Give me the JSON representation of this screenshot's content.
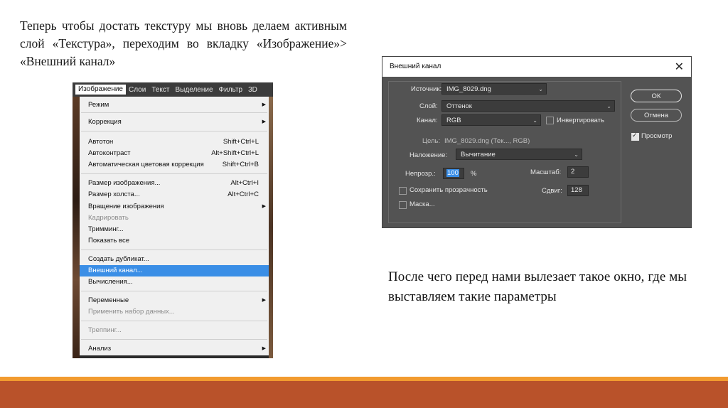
{
  "slide": {
    "top_text": "Теперь чтобы достать текстуру мы вновь делаем активным слой «Текстура», переходим во вкладку «Изображение»> «Внешний канал»",
    "bottom_text": "После чего перед нами вылезает такое окно, где мы выставляем такие параметры"
  },
  "menubar": {
    "items": [
      "Изображение",
      "Слои",
      "Текст",
      "Выделение",
      "Фильтр",
      "3D"
    ]
  },
  "image_menu": {
    "items": [
      {
        "label": "Режим",
        "shortcut": "",
        "submenu": true,
        "state": "normal"
      },
      {
        "label": "Коррекция",
        "shortcut": "",
        "submenu": true,
        "state": "normal"
      },
      {
        "label": "Автотон",
        "shortcut": "Shift+Ctrl+L",
        "submenu": false,
        "state": "normal"
      },
      {
        "label": "Автоконтраст",
        "shortcut": "Alt+Shift+Ctrl+L",
        "submenu": false,
        "state": "normal"
      },
      {
        "label": "Автоматическая цветовая коррекция",
        "shortcut": "Shift+Ctrl+B",
        "submenu": false,
        "state": "normal"
      },
      {
        "label": "Размер изображения...",
        "shortcut": "Alt+Ctrl+I",
        "submenu": false,
        "state": "normal"
      },
      {
        "label": "Размер холста...",
        "shortcut": "Alt+Ctrl+C",
        "submenu": false,
        "state": "normal"
      },
      {
        "label": "Вращение изображения",
        "shortcut": "",
        "submenu": true,
        "state": "normal"
      },
      {
        "label": "Кадрировать",
        "shortcut": "",
        "submenu": false,
        "state": "disabled"
      },
      {
        "label": "Тримминг...",
        "shortcut": "",
        "submenu": false,
        "state": "normal"
      },
      {
        "label": "Показать все",
        "shortcut": "",
        "submenu": false,
        "state": "normal"
      },
      {
        "label": "Создать дубликат...",
        "shortcut": "",
        "submenu": false,
        "state": "normal"
      },
      {
        "label": "Внешний канал...",
        "shortcut": "",
        "submenu": false,
        "state": "selected"
      },
      {
        "label": "Вычисления...",
        "shortcut": "",
        "submenu": false,
        "state": "normal"
      },
      {
        "label": "Переменные",
        "shortcut": "",
        "submenu": true,
        "state": "normal"
      },
      {
        "label": "Применить набор данных...",
        "shortcut": "",
        "submenu": false,
        "state": "disabled"
      },
      {
        "label": "Треппинг...",
        "shortcut": "",
        "submenu": false,
        "state": "disabled"
      },
      {
        "label": "Анализ",
        "shortcut": "",
        "submenu": true,
        "state": "normal"
      }
    ]
  },
  "dialog": {
    "title": "Внешний канал",
    "source_label": "Источник:",
    "source_value": "IMG_8029.dng",
    "layer_label": "Слой:",
    "layer_value": "Оттенок",
    "channel_label": "Канал:",
    "channel_value": "RGB",
    "invert_label": "Инвертировать",
    "invert_checked": false,
    "target_label": "Цель:",
    "target_value": "IMG_8029.dng (Тек..., RGB)",
    "blending_label": "Наложение:",
    "blending_value": "Вычитание",
    "opacity_label": "Непрозр.:",
    "opacity_value": "100",
    "opacity_unit": "%",
    "scale_label": "Масштаб:",
    "scale_value": "2",
    "offset_label": "Сдвиг:",
    "offset_value": "128",
    "preserve_label": "Сохранить прозрачность",
    "preserve_checked": false,
    "mask_label": "Маска...",
    "mask_checked": false,
    "ok_label": "ОК",
    "cancel_label": "Отмена",
    "preview_label": "Просмотр",
    "preview_checked": true
  },
  "colors": {
    "accent_bar": "#f29b2f",
    "footer": "#b9522a",
    "selection": "#3a8ee6"
  }
}
